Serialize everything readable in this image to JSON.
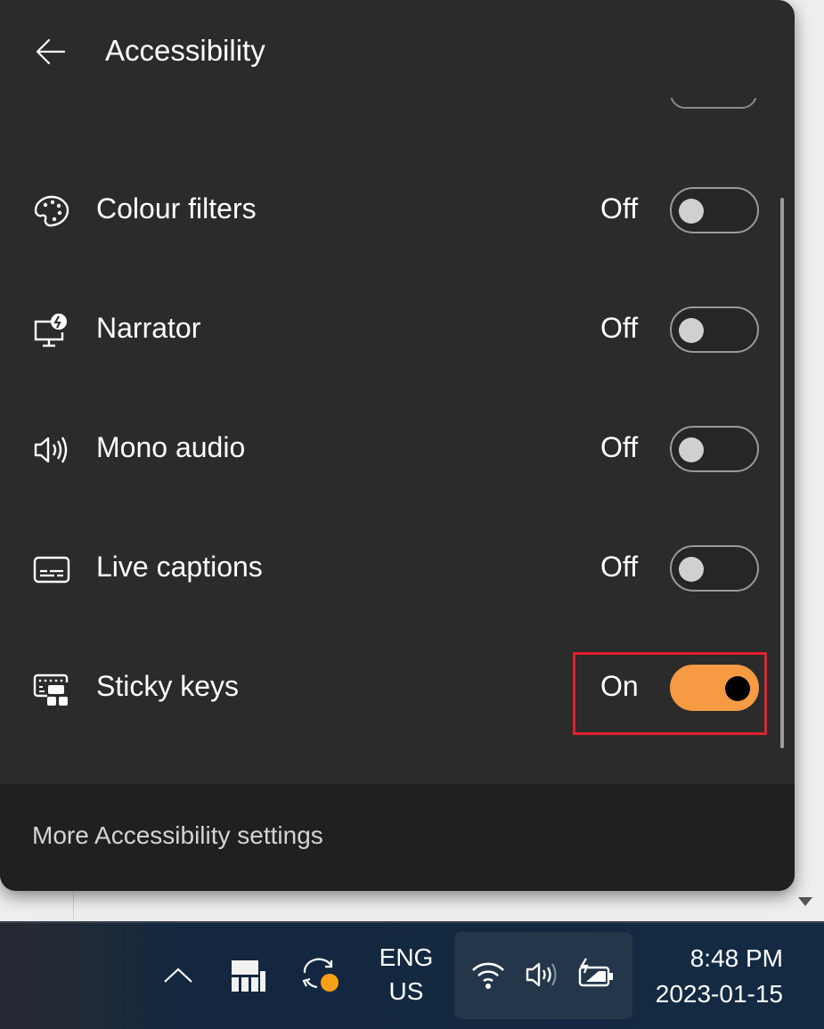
{
  "panel": {
    "title": "Accessibility",
    "back_icon": "arrow-left-icon",
    "items": [
      {
        "label": "Colour filters",
        "state": "Off",
        "on": false,
        "icon": "palette-icon"
      },
      {
        "label": "Narrator",
        "state": "Off",
        "on": false,
        "icon": "narrator-icon"
      },
      {
        "label": "Mono audio",
        "state": "Off",
        "on": false,
        "icon": "speaker-icon"
      },
      {
        "label": "Live captions",
        "state": "Off",
        "on": false,
        "icon": "captions-icon"
      },
      {
        "label": "Sticky keys",
        "state": "On",
        "on": true,
        "icon": "sticky-keys-icon"
      }
    ],
    "footer_link": "More Accessibility settings"
  },
  "colors": {
    "toggle_on": "#f69a43",
    "highlight": "#e3202a",
    "panel_bg": "#2b2b2b"
  },
  "taskbar": {
    "show_hidden_icon": "chevron-up-icon",
    "language": {
      "line1": "ENG",
      "line2": "US"
    },
    "tray_icons": [
      "wifi-icon",
      "volume-icon",
      "battery-charging-icon"
    ],
    "time": "8:48 PM",
    "date": "2023-01-15"
  }
}
